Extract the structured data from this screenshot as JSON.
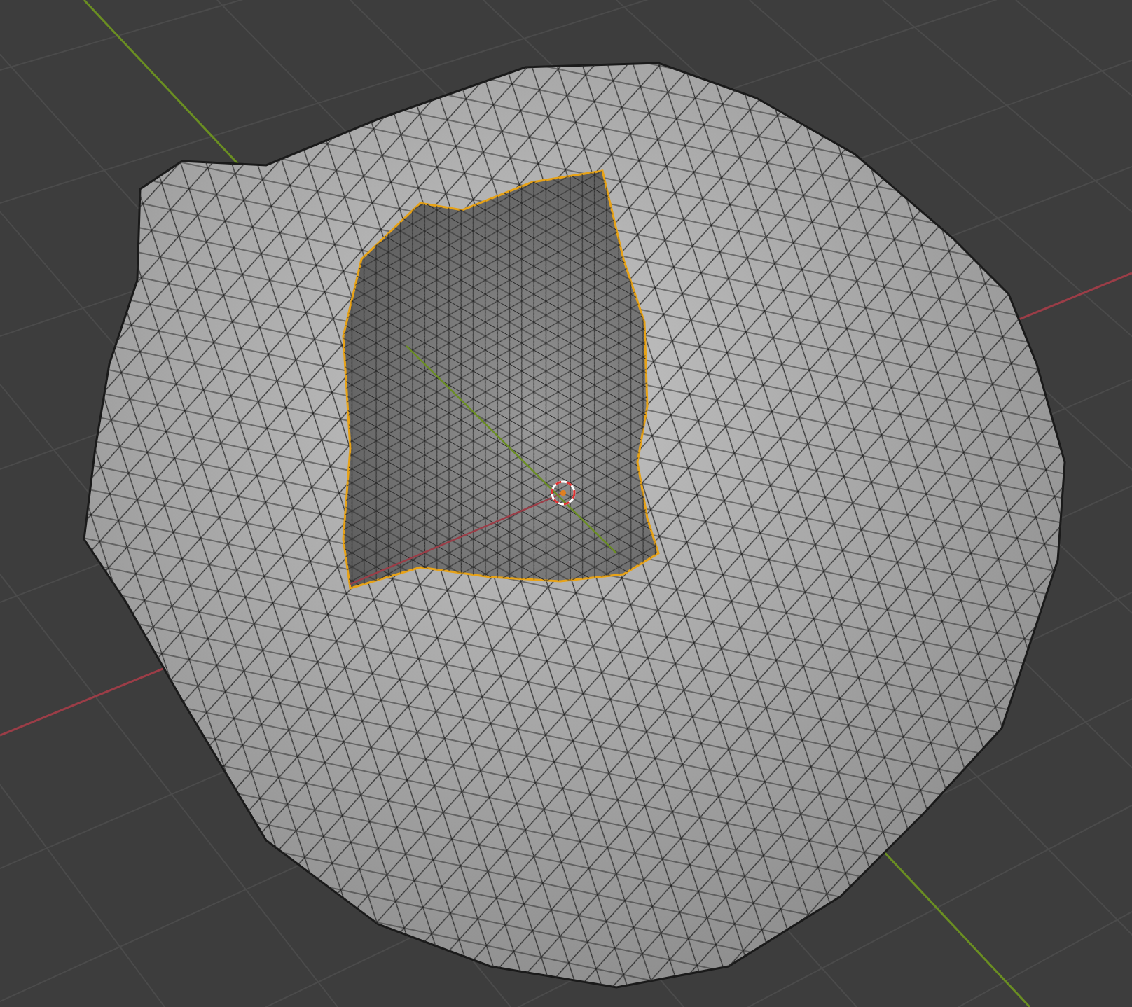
{
  "viewport": {
    "axes": [
      {
        "kind": "x",
        "color": "#9b3d47"
      },
      {
        "kind": "y",
        "color": "#6a8e22"
      }
    ],
    "mesh": {
      "wireframe": true,
      "hole_boundary_selected": true
    },
    "cursor_3d": {
      "shown": true
    }
  }
}
